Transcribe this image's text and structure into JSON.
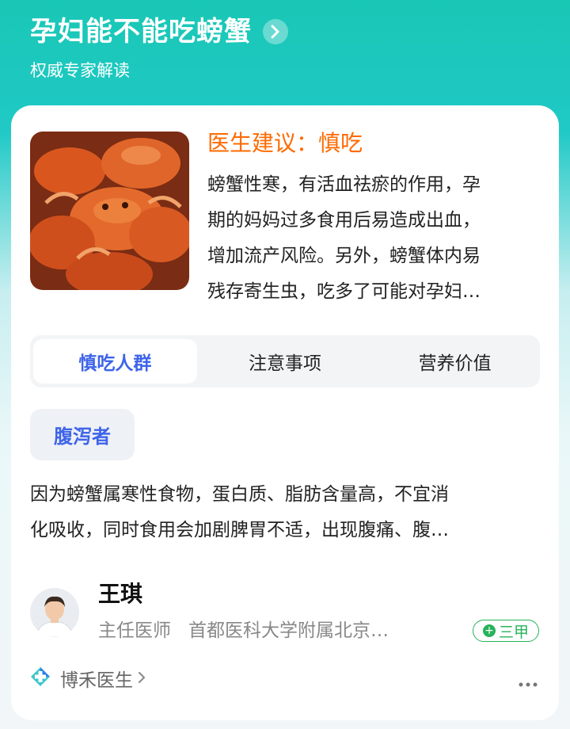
{
  "header": {
    "title": "孕妇能不能吃螃蟹",
    "subtitle": "权威专家解读"
  },
  "advice": {
    "title": "医生建议：慎吃",
    "lines": [
      "螃蟹性寒，有活血祛瘀的作用，孕",
      "期的妈妈过多食用后易造成出血，",
      "增加流产风险。另外，螃蟹体内易",
      "残存寄生虫，吃多了可能对孕妇…"
    ]
  },
  "tabs": [
    {
      "label": "慎吃人群",
      "active": true
    },
    {
      "label": "注意事项",
      "active": false
    },
    {
      "label": "营养价值",
      "active": false
    }
  ],
  "group": {
    "tag": "腹泻者",
    "lines": [
      "因为螃蟹属寒性食物，蛋白质、脂肪含量高，不宜消",
      "化吸收，同时食用会加剧脾胃不适，出现腹痛、腹…"
    ]
  },
  "doctor": {
    "name": "王琪",
    "title": "主任医师",
    "hospital": "首都医科大学附属北京…",
    "grade": "三甲"
  },
  "source": {
    "label": "博禾医生"
  },
  "colors": {
    "accent": "#ff6a00",
    "tab_active": "#3e64e8",
    "grade": "#27b35a",
    "header_gradient_start": "#19c7b5"
  },
  "icons": {
    "title_arrow": "chevron-right-icon",
    "more": "more-dots-icon",
    "source_logo": "bohe-logo-icon"
  }
}
